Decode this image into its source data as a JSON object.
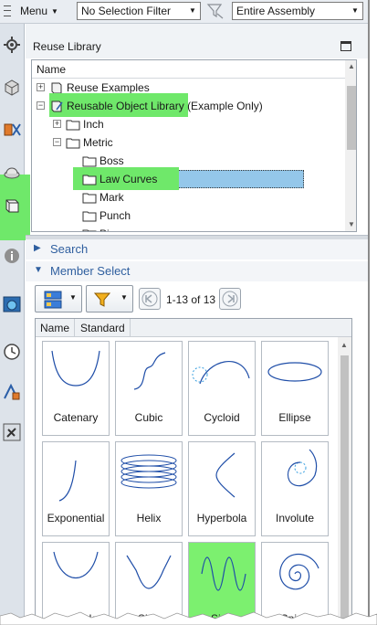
{
  "toolbar": {
    "menu_label": "Menu",
    "selection_filter": "No Selection Filter",
    "assembly_scope": "Entire Assembly"
  },
  "panel": {
    "title": "Reuse Library"
  },
  "tree": {
    "column_header": "Name",
    "rows": [
      {
        "label": "Reuse Examples",
        "level": 0,
        "expander": "+"
      },
      {
        "label": "Reusable Object Library (Example Only)",
        "level": 0,
        "expander": "-"
      },
      {
        "label": "Inch",
        "level": 1,
        "expander": "+"
      },
      {
        "label": "Metric",
        "level": 1,
        "expander": "-"
      },
      {
        "label": "Boss",
        "level": 2,
        "expander": ""
      },
      {
        "label": "Law Curves",
        "level": 2,
        "expander": "",
        "selected": true
      },
      {
        "label": "Mark",
        "level": 2,
        "expander": ""
      },
      {
        "label": "Punch",
        "level": 2,
        "expander": ""
      },
      {
        "label": "Pi",
        "level": 2,
        "expander": ""
      }
    ]
  },
  "sections": {
    "search": "Search",
    "member_select": "Member Select"
  },
  "member_select": {
    "page_range": "1-13 of 13",
    "tabs": [
      "Name",
      "Standard"
    ],
    "tiles": [
      {
        "label": "Catenary",
        "curve": "catenary"
      },
      {
        "label": "Cubic",
        "curve": "cubic"
      },
      {
        "label": "Cycloid",
        "curve": "cycloid"
      },
      {
        "label": "Ellipse",
        "curve": "ellipse"
      },
      {
        "label": "Exponential",
        "curve": "exponential"
      },
      {
        "label": "Helix",
        "curve": "helix"
      },
      {
        "label": "Hyperbola",
        "curve": "hyperbola"
      },
      {
        "label": "Involute",
        "curve": "involute"
      },
      {
        "label": "Parabola",
        "curve": "parabola"
      },
      {
        "label": "Sine",
        "curve": "sine",
        "selected": true
      },
      {
        "label": "Sine",
        "curve": "sine"
      },
      {
        "label": "Spiral",
        "curve": "spiral"
      }
    ]
  },
  "colors": {
    "highlight": "#6fe86a",
    "accent": "#2f5f9f",
    "curve": "#1f4ea8"
  }
}
